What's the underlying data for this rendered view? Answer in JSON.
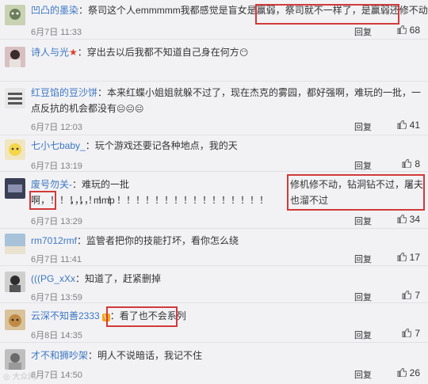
{
  "comments": [
    {
      "user": "凹凸的墨染",
      "sep": "：",
      "body": "祭司这个人emmmmm我都感觉是盲女是赢弱，",
      "highlight": "祭司就不一样了，是赢弱还修不动",
      "date": "6月7日 11:33",
      "reply": "回复",
      "likes": "68"
    },
    {
      "user": "诗人与光",
      "sep": "：",
      "body": "穿出去以后我都不知道自己身在何方",
      "date": "",
      "reply": "",
      "likes": ""
    },
    {
      "user": "红豆馅的豆沙饼",
      "sep": "：",
      "body": "本来红蝶小姐姐就躲不过了，现在杰克的雾园，都好强啊，难玩的一批，一点反抗的机会都没有",
      "date": "6月7日 12:03",
      "reply": "回复",
      "likes": "41"
    },
    {
      "user": "七小七baby_",
      "sep": "：",
      "body": "玩个游戏还要记各种地点，我的天",
      "date": "6月7日 13:19",
      "reply": "回复",
      "likes": "8"
    },
    {
      "user": "废号勿关-",
      "sep": "：",
      "body": "难玩的一批啊，！！！！！！！！！！！！！！！！！！！！！！！",
      "highlight": "修机修不动，钻洞钻不过，屠夫也溜不过",
      "tail": "，，，，mmp",
      "date": "6月7日 13:29",
      "reply": "回复",
      "likes": "34"
    },
    {
      "user": "rm7012rmf",
      "sep": "：",
      "body": "监管者把你的技能打坏，看你怎么绕",
      "date": "6月7日 11:41",
      "reply": "回复",
      "likes": "17"
    },
    {
      "user": "(((PG_xXx",
      "sep": "：",
      "body": "知道了，赶紧删掉",
      "date": "6月7日 13:59",
      "reply": "回复",
      "likes": "7"
    },
    {
      "user": "云深不知善2333",
      "sep": "：",
      "highlight": "看了也不会系列",
      "date": "6月8日 14:35",
      "reply": "回复",
      "likes": "7"
    },
    {
      "user": "才不和狮吵架",
      "sep": "：",
      "body": "明人不说暗话，我记不住",
      "date": "6月7日 14:50",
      "reply": "回复",
      "likes": "26"
    }
  ],
  "watermark": "大众网",
  "colors": {
    "username": "#3e77c1",
    "highlight_box": "#d23a3a",
    "background": "#f2f2f5"
  }
}
